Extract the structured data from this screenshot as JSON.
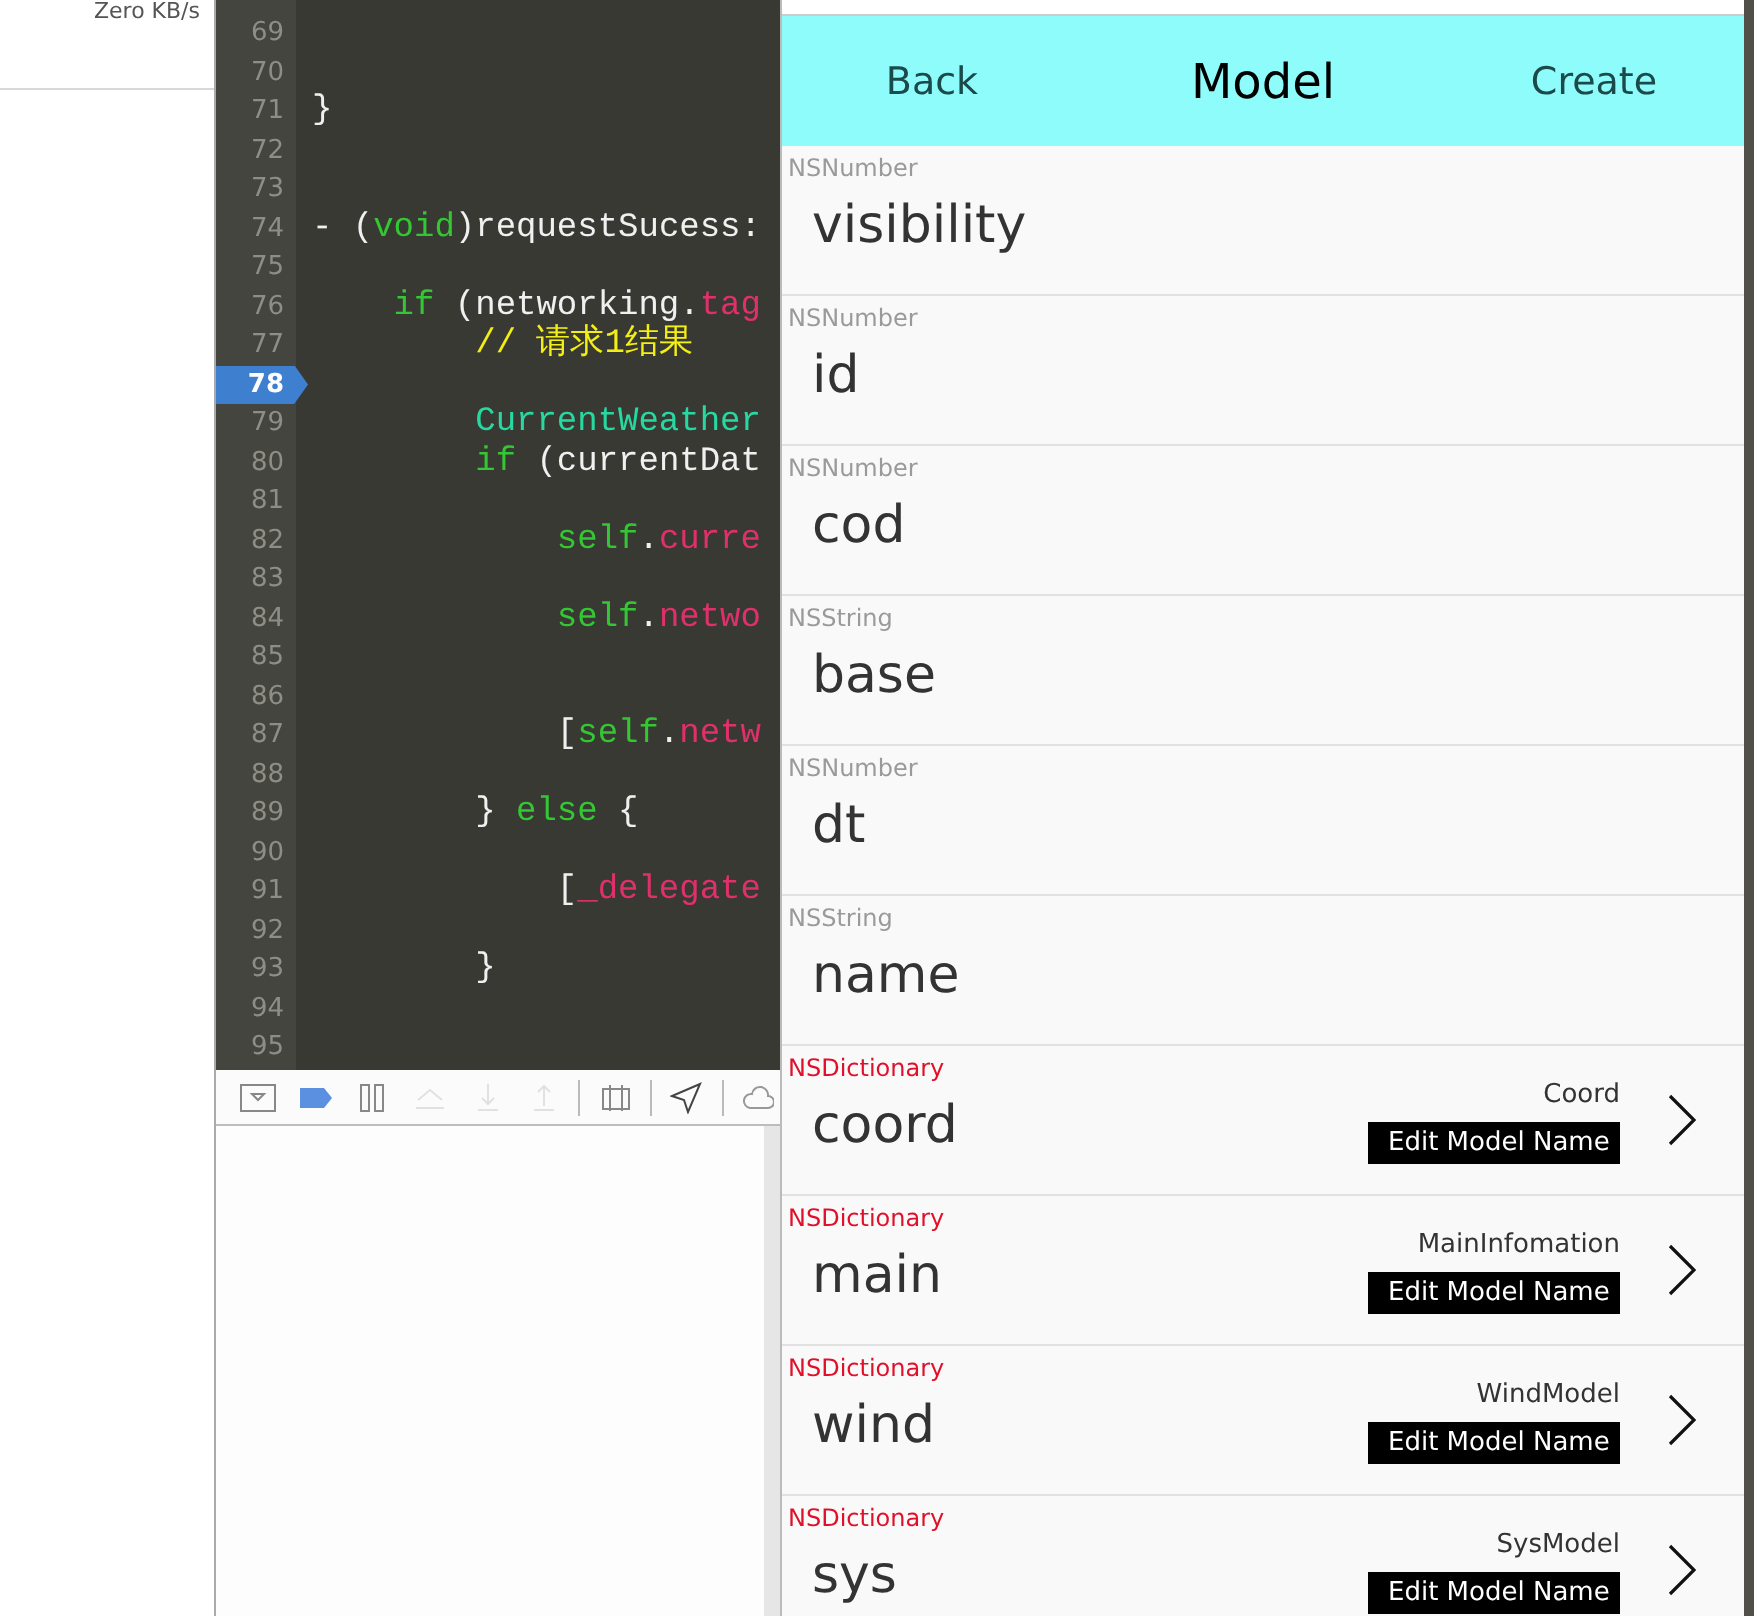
{
  "sidebar": {
    "network_speed": "Zero KB/s"
  },
  "editor": {
    "lines": [
      {
        "number": "69",
        "breakpoint": false
      },
      {
        "number": "70",
        "breakpoint": false
      },
      {
        "number": "71",
        "breakpoint": false,
        "tokens": [
          {
            "text": "}",
            "kind": "plain"
          }
        ]
      },
      {
        "number": "72",
        "breakpoint": false
      },
      {
        "number": "73",
        "breakpoint": false
      },
      {
        "number": "74",
        "breakpoint": false,
        "tokens": [
          {
            "text": "- (",
            "kind": "plain"
          },
          {
            "text": "void",
            "kind": "keyword"
          },
          {
            "text": ")requestSucess:",
            "kind": "plain"
          }
        ]
      },
      {
        "number": "75",
        "breakpoint": false
      },
      {
        "number": "76",
        "breakpoint": false,
        "tokens": [
          {
            "text": "    if",
            "kind": "keyword"
          },
          {
            "text": " (networking.",
            "kind": "plain"
          },
          {
            "text": "tag",
            "kind": "member"
          }
        ]
      },
      {
        "number": "77",
        "breakpoint": false,
        "tokens": [
          {
            "text": "        // 请求1结果",
            "kind": "comment"
          }
        ]
      },
      {
        "number": "78",
        "breakpoint": true
      },
      {
        "number": "79",
        "breakpoint": false,
        "tokens": [
          {
            "text": "        CurrentWeather",
            "kind": "type"
          }
        ]
      },
      {
        "number": "80",
        "breakpoint": false,
        "tokens": [
          {
            "text": "        if",
            "kind": "keyword"
          },
          {
            "text": " (currentDat",
            "kind": "plain"
          }
        ]
      },
      {
        "number": "81",
        "breakpoint": false
      },
      {
        "number": "82",
        "breakpoint": false,
        "tokens": [
          {
            "text": "            self",
            "kind": "keyword"
          },
          {
            "text": ".",
            "kind": "plain"
          },
          {
            "text": "curre",
            "kind": "member"
          }
        ]
      },
      {
        "number": "83",
        "breakpoint": false
      },
      {
        "number": "84",
        "breakpoint": false,
        "tokens": [
          {
            "text": "            self",
            "kind": "keyword"
          },
          {
            "text": ".",
            "kind": "plain"
          },
          {
            "text": "netwo",
            "kind": "member"
          }
        ]
      },
      {
        "number": "85",
        "breakpoint": false
      },
      {
        "number": "86",
        "breakpoint": false
      },
      {
        "number": "87",
        "breakpoint": false,
        "tokens": [
          {
            "text": "            [",
            "kind": "plain"
          },
          {
            "text": "self",
            "kind": "keyword"
          },
          {
            "text": ".",
            "kind": "plain"
          },
          {
            "text": "netw",
            "kind": "member"
          }
        ]
      },
      {
        "number": "88",
        "breakpoint": false
      },
      {
        "number": "89",
        "breakpoint": false,
        "tokens": [
          {
            "text": "        } ",
            "kind": "plain"
          },
          {
            "text": "else",
            "kind": "keyword"
          },
          {
            "text": " {",
            "kind": "plain"
          }
        ]
      },
      {
        "number": "90",
        "breakpoint": false
      },
      {
        "number": "91",
        "breakpoint": false,
        "tokens": [
          {
            "text": "            [",
            "kind": "plain"
          },
          {
            "text": "_delegate",
            "kind": "member"
          }
        ]
      },
      {
        "number": "92",
        "breakpoint": false
      },
      {
        "number": "93",
        "breakpoint": false,
        "tokens": [
          {
            "text": "        }",
            "kind": "plain"
          }
        ]
      },
      {
        "number": "94",
        "breakpoint": false
      },
      {
        "number": "95",
        "breakpoint": false
      }
    ]
  },
  "debug_toolbar": {
    "buttons": [
      {
        "kind": "hide-panel",
        "disabled": false
      },
      {
        "kind": "breakpoints",
        "disabled": false
      },
      {
        "kind": "pause",
        "disabled": false
      },
      {
        "kind": "step-over",
        "disabled": true
      },
      {
        "kind": "step-in",
        "disabled": true
      },
      {
        "kind": "step-out",
        "disabled": true
      },
      {
        "kind": "view-debug",
        "disabled": false
      },
      {
        "kind": "location",
        "disabled": false
      },
      {
        "kind": "weather",
        "disabled": false
      }
    ]
  },
  "simulator": {
    "nav_bar": {
      "back": "Back",
      "title": "Model",
      "create": "Create"
    },
    "rows": [
      {
        "kind": "value",
        "type": "NSNumber",
        "name": "visibility"
      },
      {
        "kind": "value",
        "type": "NSNumber",
        "name": "id"
      },
      {
        "kind": "value",
        "type": "NSNumber",
        "name": "cod"
      },
      {
        "kind": "value",
        "type": "NSString",
        "name": "base"
      },
      {
        "kind": "value",
        "type": "NSNumber",
        "name": "dt"
      },
      {
        "kind": "value",
        "type": "NSString",
        "name": "name"
      },
      {
        "kind": "dictionary",
        "type": "NSDictionary",
        "name": "coord",
        "model_name": "Coord",
        "button": "Edit Model Name"
      },
      {
        "kind": "dictionary",
        "type": "NSDictionary",
        "name": "main",
        "model_name": "MainInfomation",
        "button": "Edit Model Name"
      },
      {
        "kind": "dictionary",
        "type": "NSDictionary",
        "name": "wind",
        "model_name": "WindModel",
        "button": "Edit Model Name"
      },
      {
        "kind": "dictionary",
        "type": "NSDictionary",
        "name": "sys",
        "model_name": "SysModel",
        "button": "Edit Model Name"
      }
    ]
  }
}
